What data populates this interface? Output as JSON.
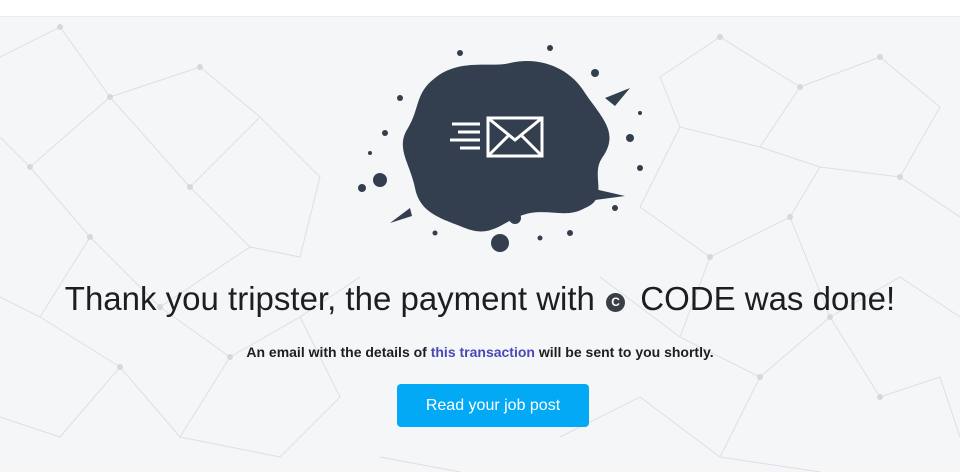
{
  "heading": {
    "before_coin": "Thank you tripster, the payment with ",
    "coin_symbol": "C",
    "after_coin": " CODE was done!"
  },
  "message": {
    "before_link": "An email with the details of ",
    "link_text": "this transaction",
    "after_link": " will be sent to you shortly."
  },
  "cta": {
    "label": "Read your job post"
  },
  "icons": {
    "illustration": "envelope-sending-icon",
    "coin": "code-coin-icon"
  },
  "colors": {
    "background": "#f5f6f8",
    "splash": "#333f4e",
    "link": "#4a47b8",
    "button": "#03a9f4",
    "text": "#1b1e22"
  }
}
